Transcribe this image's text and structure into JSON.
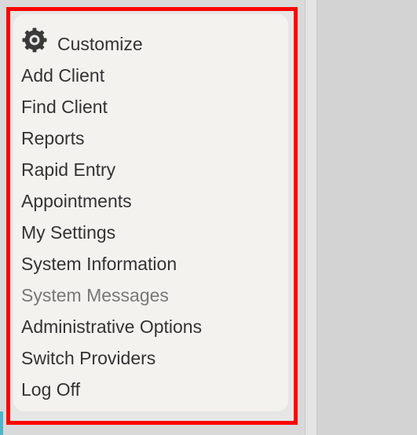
{
  "menu": {
    "items": [
      {
        "label": "Customize",
        "icon": "gear-icon"
      },
      {
        "label": "Add Client"
      },
      {
        "label": "Find Client"
      },
      {
        "label": "Reports"
      },
      {
        "label": "Rapid Entry"
      },
      {
        "label": "Appointments"
      },
      {
        "label": "My Settings"
      },
      {
        "label": "System Information"
      },
      {
        "label": "System Messages",
        "state": "disabled"
      },
      {
        "label": "Administrative Options"
      },
      {
        "label": "Switch Providers"
      },
      {
        "label": "Log Off"
      }
    ]
  },
  "colors": {
    "highlight": "#ff0000",
    "panel_background": "#f4f2ef",
    "text": "#333333",
    "text_disabled": "#777777"
  }
}
